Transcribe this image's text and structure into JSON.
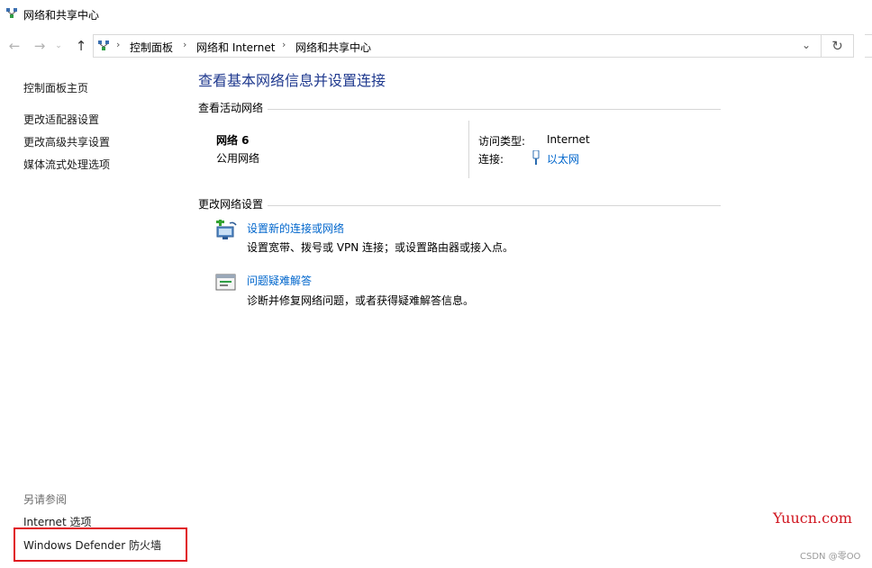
{
  "window": {
    "title": "网络和共享中心"
  },
  "address": {
    "crumbs": [
      "控制面板",
      "网络和 Internet",
      "网络和共享中心"
    ]
  },
  "sidebar": {
    "home": "控制面板主页",
    "links": [
      "更改适配器设置",
      "更改高级共享设置",
      "媒体流式处理选项"
    ],
    "see_also_title": "另请参阅",
    "see_also": [
      "Internet 选项",
      "Windows Defender 防火墙"
    ]
  },
  "main": {
    "heading": "查看基本网络信息并设置连接",
    "active_section": "查看活动网络",
    "network": {
      "name": "网络 6",
      "profile": "公用网络",
      "access_label": "访问类型:",
      "access_value": "Internet",
      "conn_label": "连接:",
      "conn_value": "以太网"
    },
    "change_section": "更改网络设置",
    "tasks": [
      {
        "link": "设置新的连接或网络",
        "desc": "设置宽带、拨号或 VPN 连接；或设置路由器或接入点。",
        "icon": "new-connection-icon"
      },
      {
        "link": "问题疑难解答",
        "desc": "诊断并修复网络问题，或者获得疑难解答信息。",
        "icon": "troubleshoot-icon"
      }
    ]
  },
  "watermark": {
    "site": "Yuucn.com",
    "author": "CSDN @零OO"
  },
  "colors": {
    "link": "#0066cc",
    "heading": "#203a8f",
    "highlight": "#e0141e"
  }
}
